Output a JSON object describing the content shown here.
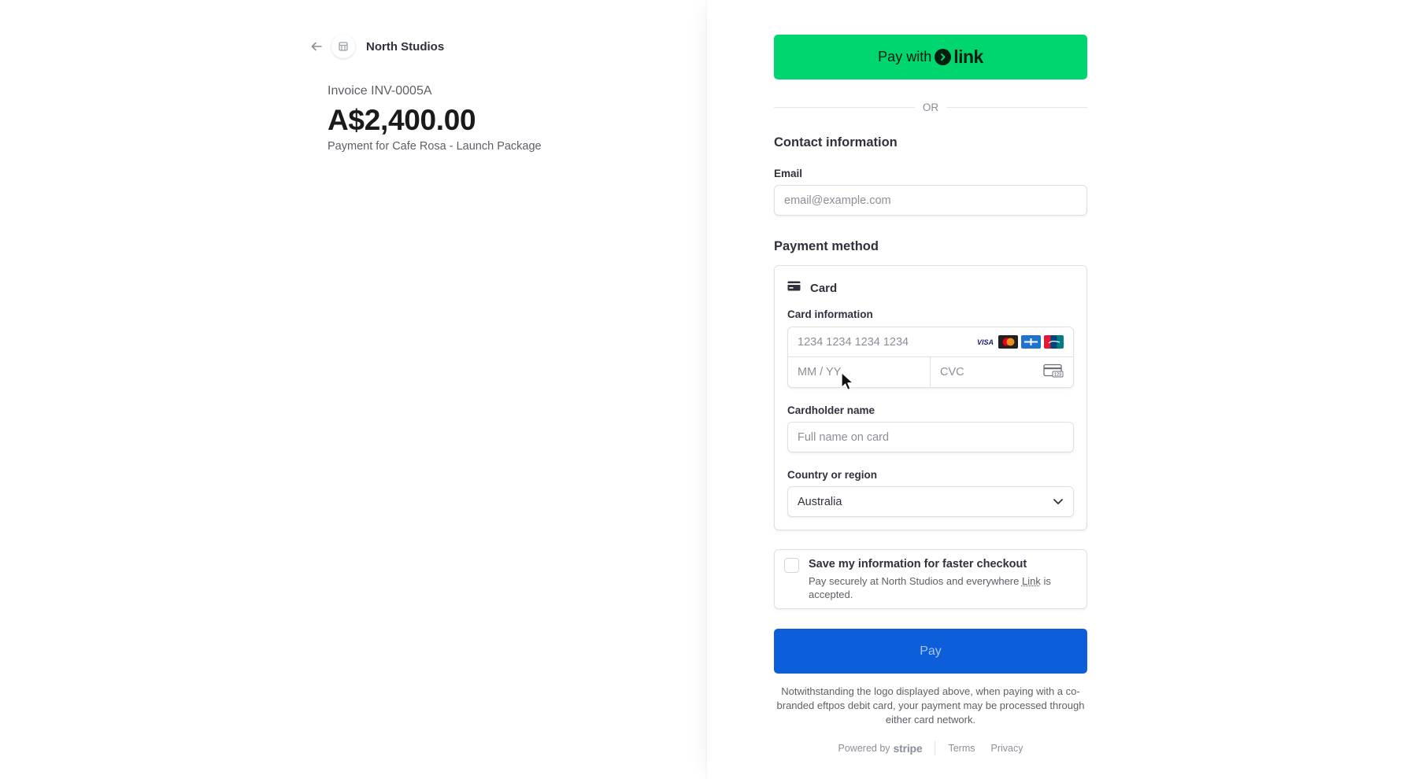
{
  "merchant": {
    "name": "North Studios",
    "back_icon": "arrow-left-icon",
    "logo_icon": "store-icon"
  },
  "invoice": {
    "label": "Invoice INV-0005A",
    "amount": "A$2,400.00",
    "description": "Payment for Cafe Rosa - Launch Package"
  },
  "link_pay": {
    "prefix": "Pay with",
    "brand": "link",
    "color": "#00d66f"
  },
  "divider": {
    "text": "OR"
  },
  "contact": {
    "title": "Contact information",
    "email_label": "Email",
    "email_placeholder": "email@example.com"
  },
  "payment": {
    "title": "Payment method",
    "tab_label": "Card",
    "tab_icon": "credit-card-icon",
    "card_info_label": "Card information",
    "card_number_placeholder": "1234 1234 1234 1234",
    "brands": [
      "VISA",
      "Mastercard",
      "American Express",
      "UnionPay"
    ],
    "expiry_placeholder": "MM / YY",
    "cvc_placeholder": "CVC",
    "cardholder_label": "Cardholder name",
    "cardholder_placeholder": "Full name on card",
    "country_label": "Country or region",
    "country_value": "Australia"
  },
  "save_info": {
    "title": "Save my information for faster checkout",
    "desc_prefix": "Pay securely at North Studios and everywhere ",
    "desc_link": "Link",
    "desc_suffix": " is accepted."
  },
  "pay_button": {
    "label": "Pay",
    "color": "#0d5ed9"
  },
  "notice": "Notwithstanding the logo displayed above, when paying with a co-branded eftpos debit card, your payment may be processed through either card network.",
  "footer": {
    "powered_by": "Powered by",
    "stripe": "stripe",
    "terms": "Terms",
    "privacy": "Privacy"
  }
}
